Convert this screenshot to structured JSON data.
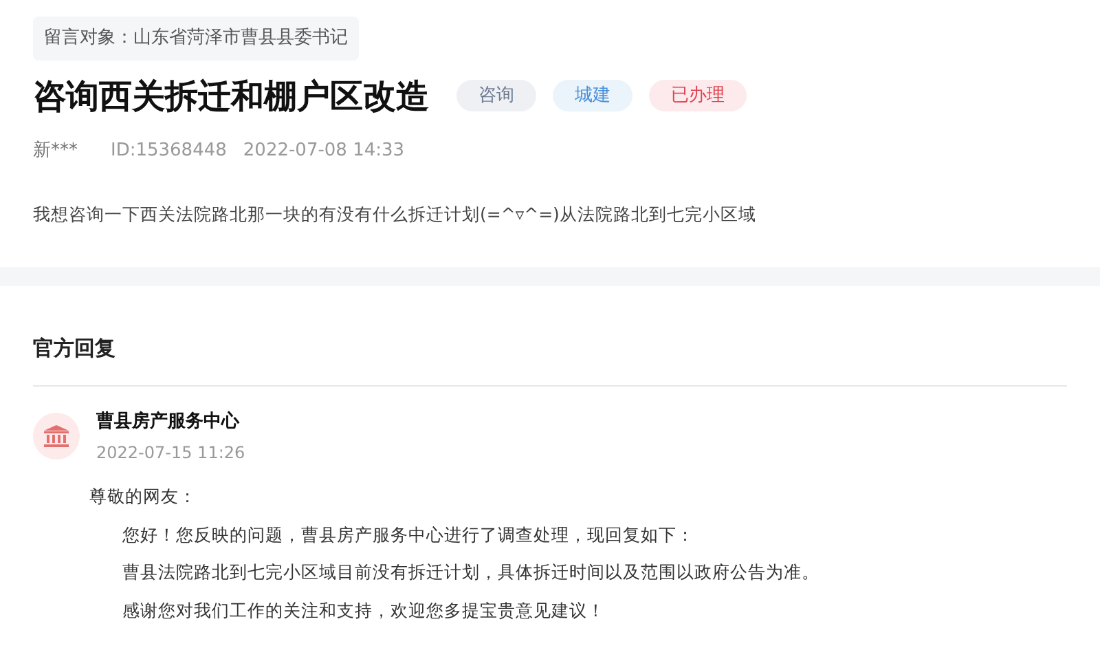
{
  "target": "留言对象：山东省菏泽市曹县县委书记",
  "title": "咨询西关拆迁和棚户区改造",
  "tags": [
    {
      "label": "咨询",
      "color": "#6b7a90"
    },
    {
      "label": "城建",
      "color": "#4a90d9"
    },
    {
      "label": "已办理",
      "color": "#e0424f"
    }
  ],
  "meta": {
    "author": "新***",
    "id": "ID:15368448",
    "time": "2022-07-08 14:33"
  },
  "question": "我想咨询一下西关法院路北那一块的有没有什么拆迁计划(=^▿^=)从法院路北到七完小区域",
  "reply_section": {
    "heading": "官方回复",
    "reply": {
      "name": "曹县房产服务中心",
      "time": "2022-07-15 11:26",
      "greeting": "尊敬的网友：",
      "paragraphs": [
        "您好！您反映的问题，曹县房产服务中心进行了调查处理，现回复如下：",
        "曹县法院路北到七完小区域目前没有拆迁计划，具体拆迁时间以及范围以政府公告为准。",
        "感谢您对我们工作的关注和支持，欢迎您多提宝贵意见建议！"
      ]
    }
  }
}
